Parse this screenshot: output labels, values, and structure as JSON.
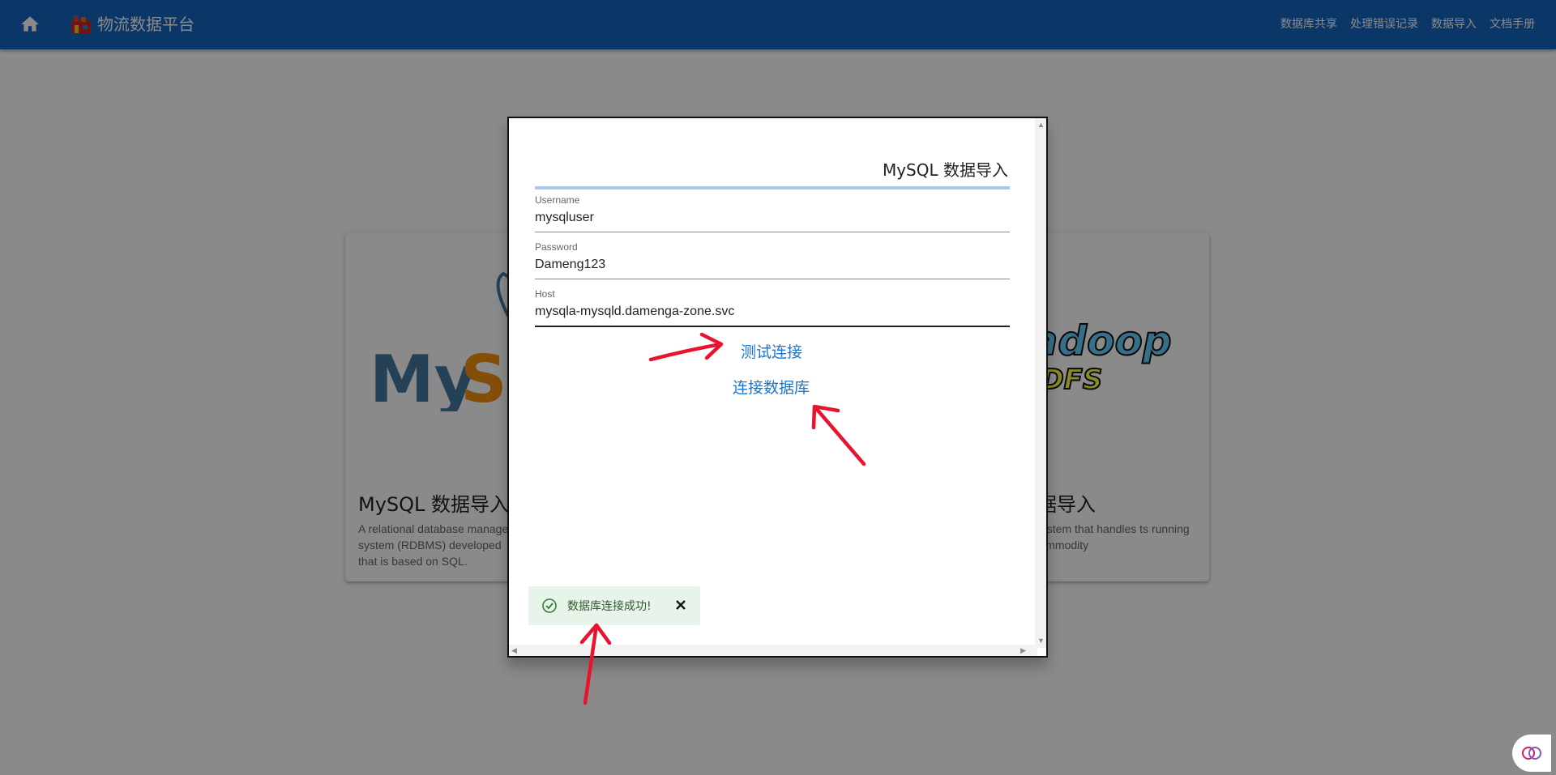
{
  "appbar": {
    "brand_title": "物流数据平台",
    "nav": [
      "数据库共享",
      "处理错误记录",
      "数据导入",
      "文档手册"
    ]
  },
  "background": {
    "cards": [
      {
        "title": "MySQL 数据导入",
        "description": "A relational database manage system (RDBMS) developed that is based on SQL.",
        "logo_text": "MySQL"
      },
      {
        "title": "数据导入",
        "description": "file system that handles ts running on commodity",
        "logo_text": "hadoop HDFS"
      }
    ]
  },
  "dialog": {
    "title": "MySQL 数据导入",
    "fields": [
      {
        "label": "Username",
        "value": "mysqluser"
      },
      {
        "label": "Password",
        "value": "Dameng123"
      },
      {
        "label": "Host",
        "value": "mysqla-mysqld.damenga-zone.svc"
      }
    ],
    "test_connection_label": "测试连接",
    "connect_db_label": "连接数据库",
    "toast": {
      "message": "数据库连接成功!",
      "type": "success"
    }
  },
  "colors": {
    "appbar": "#1565c0",
    "link": "#1976d2",
    "toast_bg": "#e8f3ea",
    "annotation_arrow": "#e8142f"
  }
}
